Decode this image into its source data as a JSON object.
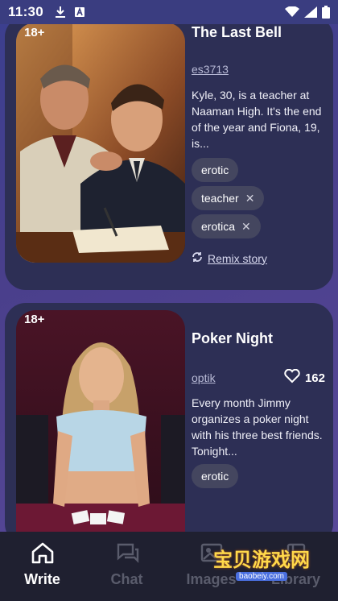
{
  "status_bar": {
    "time": "11:30"
  },
  "cards": [
    {
      "age_badge": "18+",
      "title": "The Last Bell",
      "author": "es3713",
      "description": "Kyle, 30, is a teacher at Naaman High. It's the end of the year and Fiona, 19, is...",
      "tags": [
        "erotic",
        "teacher",
        "erotica"
      ],
      "remix_label": "Remix story"
    },
    {
      "age_badge": "18+",
      "title": "Poker Night",
      "author": "optik",
      "likes": "162",
      "description": "Every month Jimmy organizes a poker night with his three best friends. Tonight...",
      "tags": [
        "erotic"
      ]
    }
  ],
  "nav": {
    "items": [
      "Write",
      "Chat",
      "Images",
      "Library"
    ]
  },
  "watermark": {
    "main": "宝贝游戏网",
    "url": "baobeiy.com"
  },
  "colors": {
    "background": "#3b3f8f",
    "card": "#2d2f55",
    "tag": "#44465f",
    "navbar": "#1f2030"
  }
}
